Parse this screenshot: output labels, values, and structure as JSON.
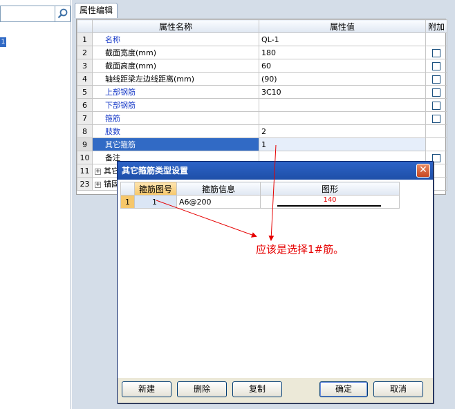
{
  "left": {
    "search": {
      "placeholder": "",
      "icon": "search-icon"
    },
    "tree_node_label": "1"
  },
  "tab": {
    "label": "属性编辑"
  },
  "grid": {
    "headers": {
      "num": "",
      "name": "属性名称",
      "value": "属性值",
      "extra": "附加"
    },
    "rows": [
      {
        "num": "1",
        "name": "名称",
        "value": "QL-1",
        "check": false,
        "blue": true
      },
      {
        "num": "2",
        "name": "截面宽度(mm)",
        "value": "180",
        "check": true,
        "blue": false
      },
      {
        "num": "3",
        "name": "截面高度(mm)",
        "value": "60",
        "check": true,
        "blue": false
      },
      {
        "num": "4",
        "name": "轴线距梁左边线距离(mm)",
        "value": "(90)",
        "check": true,
        "blue": false
      },
      {
        "num": "5",
        "name": "上部钢筋",
        "value": "3C10",
        "check": true,
        "blue": true
      },
      {
        "num": "6",
        "name": "下部钢筋",
        "value": "",
        "check": true,
        "blue": true
      },
      {
        "num": "7",
        "name": "箍筋",
        "value": "",
        "check": true,
        "blue": true
      },
      {
        "num": "8",
        "name": "肢数",
        "value": "2",
        "check": false,
        "blue": true
      },
      {
        "num": "9",
        "name": "其它箍筋",
        "value": "1",
        "check": false,
        "blue": false,
        "selected": true
      },
      {
        "num": "10",
        "name": "备注",
        "value": "",
        "check": true,
        "blue": false
      },
      {
        "num": "11",
        "name": "其它",
        "value": "",
        "check": false,
        "blue": false,
        "expander": "+"
      },
      {
        "num": "23",
        "name": "锚固",
        "value": "",
        "check": false,
        "blue": false,
        "expander": "+"
      }
    ]
  },
  "dialog": {
    "title": "其它箍筋类型设置",
    "close": "✕",
    "headers": {
      "rownum": "",
      "num": "箍筋图号",
      "info": "箍筋信息",
      "shape": "图形"
    },
    "rows": [
      {
        "rownum": "1",
        "num": "1",
        "info": "A6@200",
        "shape_value": "140"
      }
    ],
    "buttons": {
      "new": "新建",
      "delete": "删除",
      "copy": "复制",
      "ok": "确定",
      "cancel": "取消"
    }
  },
  "annotation": "应该是选择1#筋。",
  "colors": {
    "accent": "#316ac5",
    "annotation": "#e60000",
    "title_bar": "#2d63c7"
  }
}
